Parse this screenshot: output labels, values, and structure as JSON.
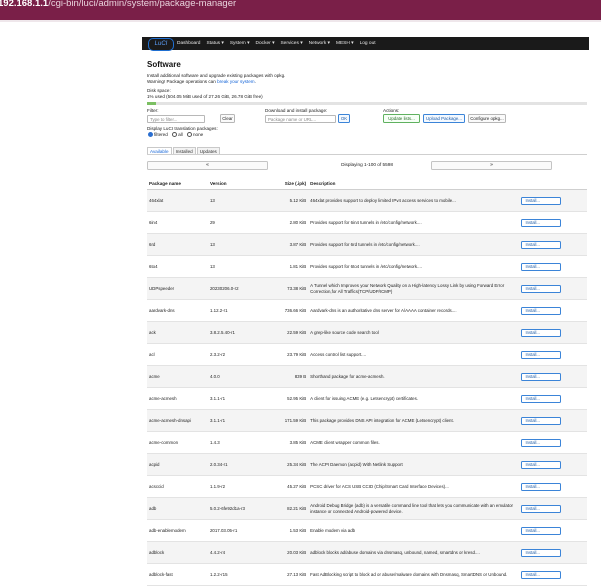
{
  "browser": {
    "host": "192.168.1.1",
    "path": "/cgi-bin/luci/admin/system/package-manager"
  },
  "nav": {
    "logo": "LuCI",
    "items": [
      "Dashboard",
      "Status ▾",
      "System ▾",
      "Docker ▾",
      "Services ▾",
      "Network ▾",
      "MESH ▾",
      "Log out"
    ]
  },
  "page": {
    "title": "Software",
    "desc_line1": "Install additional software and upgrade existing packages with opkg.",
    "desc_line2_prefix": "Warning! Package operations can ",
    "desc_line2_link": "break your system",
    "desc_line2_suffix": ".",
    "disk_label": "Disk space:",
    "disk_text": "1% used (504.05 MiB used of 27.26 GiB, 26.78 GiB free)",
    "disk_used_fraction": 0.02
  },
  "filter": {
    "label": "Filter:",
    "placeholder": "Type to filter...",
    "clear": "Clear"
  },
  "download": {
    "label": "Download and install package:",
    "placeholder": "Package name or URL...",
    "ok": "OK"
  },
  "actions": {
    "label": "Actions:",
    "update": "Update lists...",
    "upload": "Upload Package...",
    "configure": "Configure opkg..."
  },
  "translations": {
    "label": "Display LuCI translation packages:",
    "opt_filtered": "filtered",
    "opt_all": "all",
    "opt_none": "none"
  },
  "tabs": [
    "Available",
    "Installed",
    "Updates"
  ],
  "pager": {
    "prev": "«",
    "next": "»",
    "info": "Displaying 1-100 of 5598"
  },
  "table": {
    "headers": [
      "Package name",
      "Version",
      "Size (.ipk)",
      "Description",
      ""
    ],
    "install_label": "Install...",
    "rows": [
      [
        "464xlat",
        "13",
        "5.12 KiB",
        "464xlat provides support to deploy limited IPv4 access services to mobile..."
      ],
      [
        "6in4",
        "29",
        "2.80 KiB",
        "Provides support for 6in4 tunnels in /etc/config/network...."
      ],
      [
        "6rd",
        "13",
        "3.87 KiB",
        "Provides support for 6rd tunnels in /etc/config/network...."
      ],
      [
        "6to4",
        "13",
        "1.81 KiB",
        "Provides support for 6to4 tunnels in /etc/config/network...."
      ],
      [
        "UDPspeeder",
        "20230206.0-r2",
        "73.38 KiB",
        "A Tunnel which Improves your Network Quality on a High-latency Lossy Link by using Forward Error Correction,for All Traffics(TCP/UDP/ICMP)"
      ],
      [
        "aardvark-dns",
        "1.12.2-r1",
        "736.66 KiB",
        "Aardvark-dns is an authoritative dns server for A/AAAA container records...."
      ],
      [
        "ack",
        "3.8.2.5.40-r1",
        "22.59 KiB",
        "A grep-like source code search tool"
      ],
      [
        "acl",
        "2.3.2-r2",
        "23.79 KiB",
        "Access control list support...."
      ],
      [
        "acme",
        "4.0.0",
        "839 B",
        "Shorthand package for acme-acmesh."
      ],
      [
        "acme-acmesh",
        "3.1.1-r1",
        "52.95 KiB",
        "A client for issuing ACME (e.g. Letsencrypt) certificates."
      ],
      [
        "acme-acmesh-dnsapi",
        "3.1.1-r1",
        "171.59 KiB",
        "This package provides DNS API integration for ACME (Letsencrypt) client."
      ],
      [
        "acme-common",
        "1.4.3",
        "3.85 KiB",
        "ACME client wrapper common files."
      ],
      [
        "acpid",
        "2.0.34-r1",
        "25.34 KiB",
        "The ACPI Daemon (acpid) With Netlink Support"
      ],
      [
        "acsccid",
        "1.1.9-r2",
        "45.27 KiB",
        "PCSC driver for ACS USB CCID (Chip/Smart Card Interface Devices)..."
      ],
      [
        "adb",
        "5.0.2-6fe92d1a-r3",
        "82.21 KiB",
        "Android Debug Bridge (adb) is a versatile command line tool that lets you communicate with an emulator instance or connected Android-powered device."
      ],
      [
        "adb-enablemodem",
        "2017.03.05-r1",
        "1.53 KiB",
        "Enable modem via adb"
      ],
      [
        "adblock",
        "4.4.2-r4",
        "20.03 KiB",
        "adblock blocks ad/abuse domains via dnsmasq, unbound, named, smartdns or kresd...."
      ],
      [
        "adblock-fast",
        "1.2.2-r15",
        "27.13 KiB",
        "Fast AdBlocking script to block ad or abuse/malware domains with Dnsmasq, SmartDNS or Unbound."
      ]
    ]
  }
}
